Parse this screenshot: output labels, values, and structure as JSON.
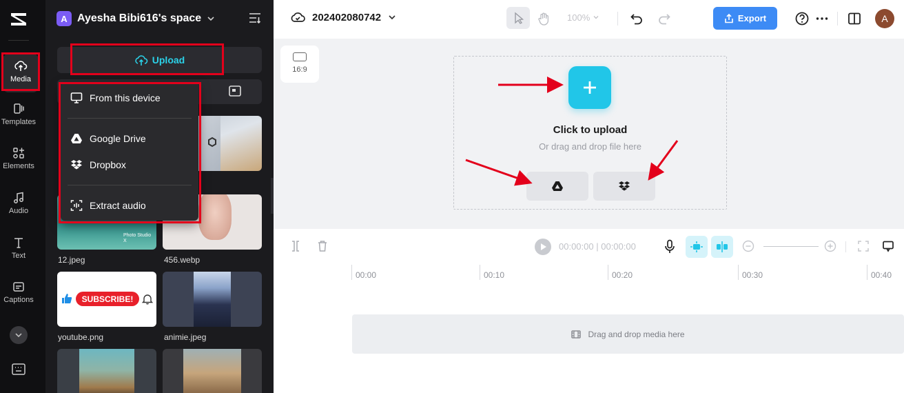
{
  "rail": {
    "items": [
      {
        "label": "Media",
        "icon": "cloud-upload-icon"
      },
      {
        "label": "Templates",
        "icon": "templates-icon"
      },
      {
        "label": "Elements",
        "icon": "elements-icon"
      },
      {
        "label": "Audio",
        "icon": "music-note-icon"
      },
      {
        "label": "Text",
        "icon": "text-icon"
      },
      {
        "label": "Captions",
        "icon": "captions-icon"
      }
    ]
  },
  "panel": {
    "space_badge": "A",
    "space_name": "Ayesha Bibi616's space",
    "upload_label": "Upload",
    "media": [
      {
        "name": "12.jpeg"
      },
      {
        "name": "456.webp"
      },
      {
        "name": "youtube.png"
      },
      {
        "name": "animie.jpeg"
      }
    ],
    "subscribe_text": "SUBSCRIBE!",
    "watermark_text": "Photo Studio X"
  },
  "upload_menu": {
    "items": [
      {
        "label": "From this device",
        "icon": "monitor-icon"
      },
      {
        "label": "Google Drive",
        "icon": "google-drive-icon"
      },
      {
        "label": "Dropbox",
        "icon": "dropbox-icon"
      },
      {
        "label": "Extract audio",
        "icon": "extract-audio-icon"
      }
    ]
  },
  "topbar": {
    "project_name": "202402080742",
    "zoom": "100%",
    "export_label": "Export",
    "avatar_letter": "A"
  },
  "canvas": {
    "ratio": "16:9",
    "click_title": "Click to upload",
    "click_subtitle": "Or drag and drop file here"
  },
  "timeline": {
    "current_time": "00:00:00",
    "total_time": "00:00:00",
    "ruler": [
      "00:00",
      "00:10",
      "00:20",
      "00:30",
      "00:40"
    ],
    "drop_text": "Drag and drop media here"
  },
  "colors": {
    "accent": "#21c6e8",
    "export": "#3d8bf5",
    "annotation_red": "#e3001b",
    "panel_bg": "#1b1b1e"
  }
}
